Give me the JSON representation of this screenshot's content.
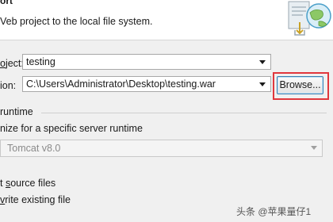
{
  "header": {
    "title": "ort",
    "description": "Veb project to the local file system."
  },
  "form": {
    "project_label_pre": "",
    "project_label_mnemonic": "o",
    "project_label_post": "ject:",
    "project_value": "testing",
    "destination_label": "ion:",
    "destination_value": "C:\\Users\\Administrator\\Desktop\\testing.war",
    "browse_button": "Browse...",
    "runtime_group_label": "runtime",
    "optimize_label": "nize for a specific server runtime",
    "server_runtime_value": "Tomcat v8.0",
    "export_source_pre": "t ",
    "export_source_mnemonic": "s",
    "export_source_post": "ource files",
    "overwrite_pre": "",
    "overwrite_mnemonic": "v",
    "overwrite_post": "rite existing file"
  },
  "watermark": "头条 @苹果量仔1"
}
